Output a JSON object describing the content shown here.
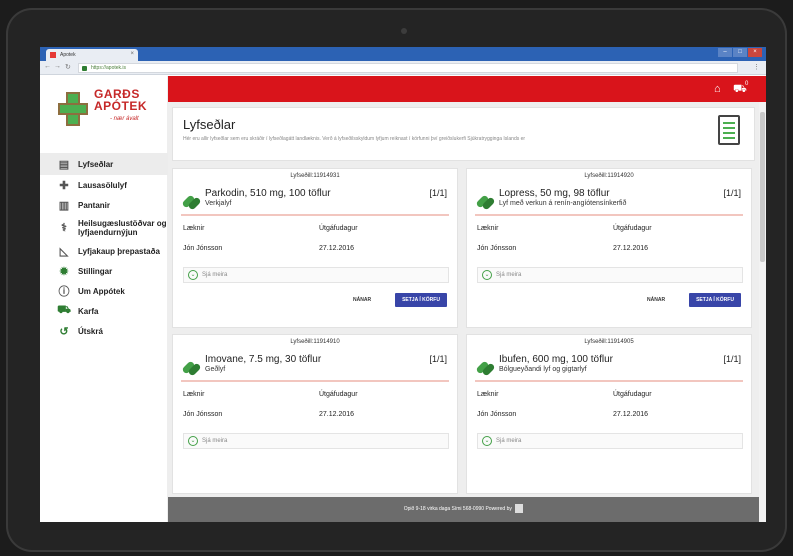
{
  "browser": {
    "tab_title": "Apotek",
    "url": "https://apotek.is",
    "nav_icons": [
      "back-arrow",
      "forward-arrow",
      "reload",
      "lock"
    ],
    "window_controls": [
      "–",
      "□",
      "×"
    ]
  },
  "brand": {
    "name_line1": "GARÐS",
    "name_line2": "APÓTEK",
    "tagline": "- nær ávalt"
  },
  "sidebar": {
    "items": [
      {
        "label": "Lyfseðlar",
        "icon": "prescription-icon",
        "active": true
      },
      {
        "label": "Lausasölulyf",
        "icon": "otc-medicine-icon"
      },
      {
        "label": "Pantanir",
        "icon": "orders-icon"
      },
      {
        "label": "Heilsugæslustöðvar og lyfjaendurnýjun",
        "icon": "health-center-icon"
      },
      {
        "label": "Lyfjakaup þrepastaða",
        "icon": "chart-icon"
      },
      {
        "label": "Stillingar",
        "icon": "settings-icon"
      },
      {
        "label": "Um Appótek",
        "icon": "info-icon"
      },
      {
        "label": "Karfa",
        "icon": "cart-icon"
      },
      {
        "label": "Útskrá",
        "icon": "logout-icon"
      }
    ]
  },
  "header": {
    "cart_count": "0"
  },
  "page": {
    "title": "Lyfseðlar",
    "description": "Hér eru allir lyfseðlar sem eru skráðir í lyfseðlagátt landlæknis. Verð á lyfseðilsskyldum lyfjum reiknast í körfunni því greiðslukerfi Sjúkratrygginga Íslands er"
  },
  "labels": {
    "doctor": "Læknir",
    "issued": "Útgáfudagur",
    "see_more": "Sjá meira",
    "details_button": "NÁNAR",
    "add_to_cart_button": "SETJA Í KÖRFU"
  },
  "cards": [
    {
      "number": "Lyfseðill:11914931",
      "name": "Parkodin, 510 mg, 100 töflur",
      "type": "Verkjalyf",
      "qty": "[1/1]",
      "doctor": "Jón Jónsson",
      "date": "27.12.2016"
    },
    {
      "number": "Lyfseðill:11914920",
      "name": "Lopress, 50 mg, 98 töflur",
      "type": "Lyf með verkun á renín-angíótensínkerfið",
      "qty": "[1/1]",
      "doctor": "Jón Jónsson",
      "date": "27.12.2016"
    },
    {
      "number": "Lyfseðill:11914910",
      "name": "Imovane, 7.5 mg, 30 töflur",
      "type": "Geðlyf",
      "qty": "[1/1]",
      "doctor": "Jón Jónsson",
      "date": "27.12.2016"
    },
    {
      "number": "Lyfseðill:11914905",
      "name": "Ibufen, 600 mg, 100 töflur",
      "type": "Bólgueyðandi lyf og gigtarlyf",
      "qty": "[1/1]",
      "doctor": "Jón Jónsson",
      "date": "27.12.2016"
    }
  ],
  "footer": {
    "text": "Opið 9-18 virka daga   Sími 568-0990  Powered by"
  },
  "colors": {
    "brand_red": "#d9141b",
    "button_blue": "#3845a8",
    "pill_green": "#43a047"
  }
}
